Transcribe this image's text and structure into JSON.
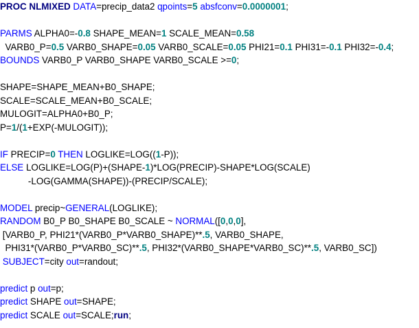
{
  "code_lines": [
    {
      "tokens": [
        {
          "t": "PROC NLMIXED",
          "c": "kwb"
        },
        {
          "t": " "
        },
        {
          "t": "DATA",
          "c": "kw"
        },
        {
          "t": "=precip_data2 "
        },
        {
          "t": "qpoints",
          "c": "kw"
        },
        {
          "t": "="
        },
        {
          "t": "5",
          "c": "num"
        },
        {
          "t": " "
        },
        {
          "t": "absfconv",
          "c": "kw"
        },
        {
          "t": "="
        },
        {
          "t": "0.0000001",
          "c": "num"
        },
        {
          "t": ";"
        }
      ]
    },
    {
      "tokens": [
        {
          "t": "PARMS",
          "c": "kw"
        },
        {
          "t": " ALPHA0=-"
        },
        {
          "t": "0.8",
          "c": "num"
        },
        {
          "t": " SHAPE_MEAN="
        },
        {
          "t": "1",
          "c": "num"
        },
        {
          "t": " SCALE_MEAN="
        },
        {
          "t": "0.58",
          "c": "num"
        }
      ]
    },
    {
      "tokens": [
        {
          "t": "  VARB0_P="
        },
        {
          "t": "0.5",
          "c": "num"
        },
        {
          "t": " VARB0_SHAPE="
        },
        {
          "t": "0.05",
          "c": "num"
        },
        {
          "t": " VARB0_SCALE="
        },
        {
          "t": "0.05",
          "c": "num"
        },
        {
          "t": " PHI21="
        },
        {
          "t": "0.1",
          "c": "num"
        },
        {
          "t": " PHI31=-"
        },
        {
          "t": "0.1",
          "c": "num"
        },
        {
          "t": " PHI32=-"
        },
        {
          "t": "0.4",
          "c": "num"
        },
        {
          "t": ";"
        }
      ]
    },
    {
      "tokens": [
        {
          "t": "BOUNDS",
          "c": "kw"
        },
        {
          "t": " VARB0_P VARB0_SHAPE VARB0_SCALE >="
        },
        {
          "t": "0",
          "c": "num"
        },
        {
          "t": ";"
        }
      ]
    },
    {
      "tokens": [
        {
          "t": "SHAPE=SHAPE_MEAN+B0_SHAPE;"
        }
      ]
    },
    {
      "tokens": [
        {
          "t": "SCALE=SCALE_MEAN+B0_SCALE;"
        }
      ]
    },
    {
      "tokens": [
        {
          "t": "MULOGIT=ALPHA0+B0_P;"
        }
      ]
    },
    {
      "tokens": [
        {
          "t": "P="
        },
        {
          "t": "1",
          "c": "num"
        },
        {
          "t": "/("
        },
        {
          "t": "1",
          "c": "num"
        },
        {
          "t": "+EXP(-MULOGIT));"
        }
      ]
    },
    {
      "tokens": [
        {
          "t": "IF",
          "c": "kw"
        },
        {
          "t": " PRECIP="
        },
        {
          "t": "0",
          "c": "num"
        },
        {
          "t": " "
        },
        {
          "t": "THEN",
          "c": "kw"
        },
        {
          "t": " LOGLIKE=LOG(("
        },
        {
          "t": "1",
          "c": "num"
        },
        {
          "t": "-P));"
        }
      ]
    },
    {
      "tokens": [
        {
          "t": "ELSE",
          "c": "kw"
        },
        {
          "t": " LOGLIKE=LOG(P)+(SHAPE-"
        },
        {
          "t": "1",
          "c": "num"
        },
        {
          "t": ")*LOG(PRECIP)-SHAPE*LOG(SCALE)"
        }
      ]
    },
    {
      "tokens": [
        {
          "t": "           -LOG(GAMMA(SHAPE))-(PRECIP/SCALE);"
        }
      ]
    },
    {
      "tokens": [
        {
          "t": "MODEL",
          "c": "kw"
        },
        {
          "t": " precip~"
        },
        {
          "t": "GENERAL",
          "c": "fn"
        },
        {
          "t": "(LOGLIKE);"
        }
      ]
    },
    {
      "tokens": [
        {
          "t": "RANDOM",
          "c": "kw"
        },
        {
          "t": " B0_P B0_SHAPE B0_SCALE ~ "
        },
        {
          "t": "NORMAL",
          "c": "fn"
        },
        {
          "t": "(["
        },
        {
          "t": "0",
          "c": "num"
        },
        {
          "t": ","
        },
        {
          "t": "0",
          "c": "num"
        },
        {
          "t": ","
        },
        {
          "t": "0",
          "c": "num"
        },
        {
          "t": "],"
        }
      ]
    },
    {
      "tokens": [
        {
          "t": " [VARB0_P, PHI21*(VARB0_P*VARB0_SHAPE)**"
        },
        {
          "t": ".5",
          "c": "num"
        },
        {
          "t": ", VARB0_SHAPE,"
        }
      ]
    },
    {
      "tokens": [
        {
          "t": "  PHI31*(VARB0_P*VARB0_SC)**"
        },
        {
          "t": ".5",
          "c": "num"
        },
        {
          "t": ", PHI32*(VARB0_SHAPE*VARB0_SC)**"
        },
        {
          "t": ".5",
          "c": "num"
        },
        {
          "t": ", VARB0_SC])"
        }
      ]
    },
    {
      "tokens": [
        {
          "t": " "
        },
        {
          "t": "SUBJECT",
          "c": "kw"
        },
        {
          "t": "=city "
        },
        {
          "t": "out",
          "c": "kw"
        },
        {
          "t": "=randout;"
        }
      ]
    },
    {
      "tokens": [
        {
          "t": "predict",
          "c": "kw"
        },
        {
          "t": " p "
        },
        {
          "t": "out",
          "c": "kw"
        },
        {
          "t": "=p;"
        }
      ]
    },
    {
      "tokens": [
        {
          "t": "predict",
          "c": "kw"
        },
        {
          "t": " SHAPE "
        },
        {
          "t": "out",
          "c": "kw"
        },
        {
          "t": "=SHAPE;"
        }
      ]
    },
    {
      "tokens": [
        {
          "t": "predict",
          "c": "kw"
        },
        {
          "t": " SCALE "
        },
        {
          "t": "out",
          "c": "kw"
        },
        {
          "t": "=SCALE;"
        },
        {
          "t": "run",
          "c": "run"
        },
        {
          "t": ";"
        }
      ]
    }
  ]
}
